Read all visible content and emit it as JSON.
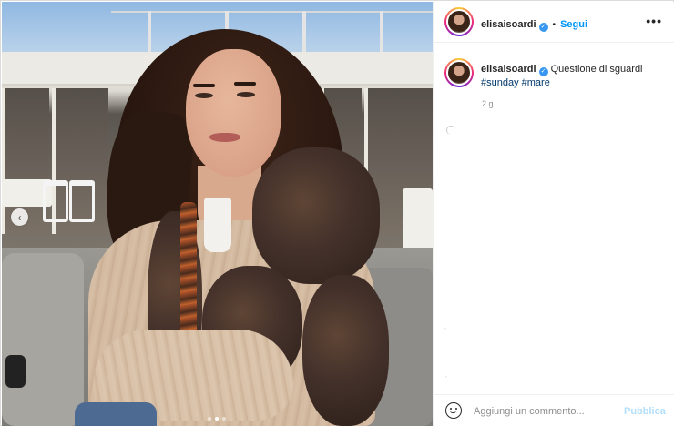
{
  "post": {
    "username": "elisaisoardi",
    "verified": true,
    "separator": "•",
    "follow_label": "Segui",
    "more_label": "•••",
    "caption_text": "Questione di sguardi",
    "hashtags": [
      "#sunday",
      "#mare"
    ],
    "time": "2 g"
  },
  "carousel": {
    "prev_label": "‹",
    "total_slides": 3,
    "active_slide": 2
  },
  "comment": {
    "placeholder": "Aggiungi un commento...",
    "publish_label": "Pubblica"
  },
  "colors": {
    "accent": "#0095f6",
    "hashtag": "#00376b",
    "verified": "#3897f0",
    "publish_disabled": "#b2dffc"
  },
  "icons": {
    "verified": "verified-badge-icon",
    "more": "more-options-icon",
    "emoji": "emoji-icon",
    "prev": "chevron-left-icon"
  }
}
